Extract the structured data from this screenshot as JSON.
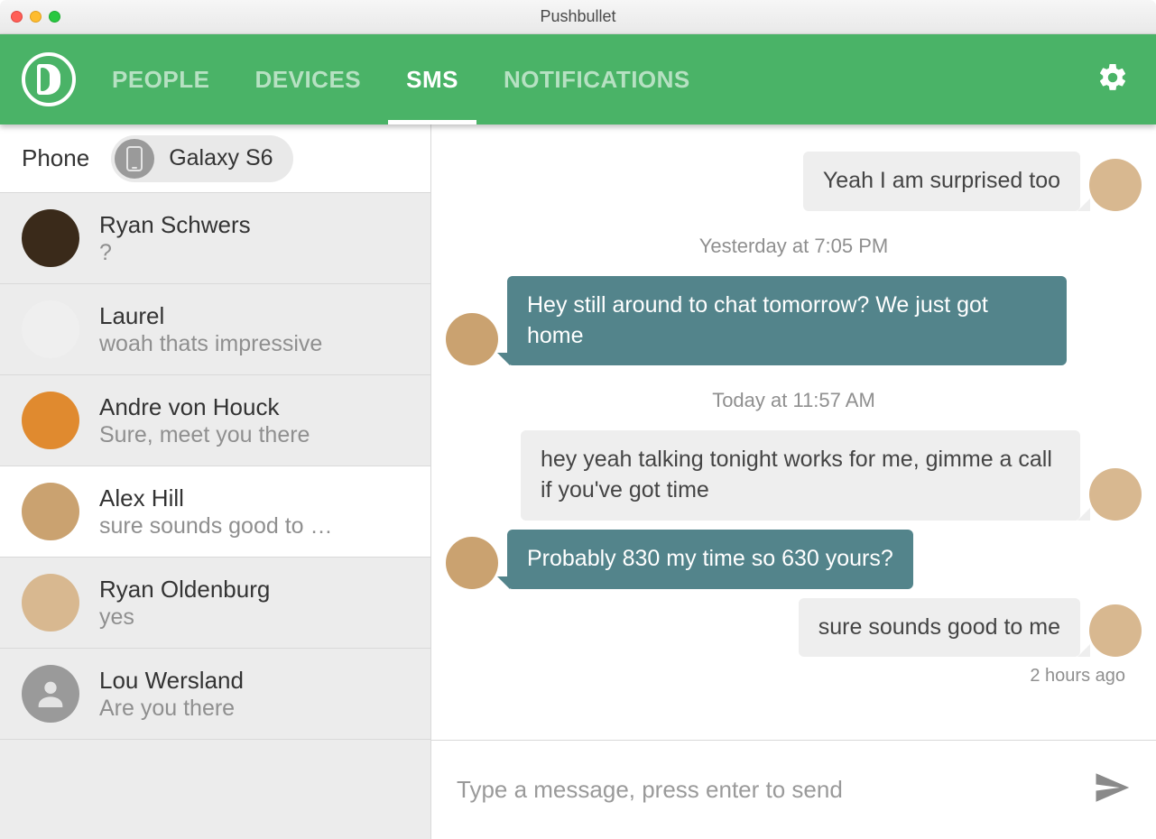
{
  "window": {
    "title": "Pushbullet"
  },
  "header": {
    "tabs": {
      "people": "PEOPLE",
      "devices": "DEVICES",
      "sms": "SMS",
      "notifications": "NOTIFICATIONS"
    },
    "active_tab": "sms"
  },
  "sidebar": {
    "phone_label": "Phone",
    "device_name": "Galaxy S6",
    "conversations": [
      {
        "name": "Ryan Schwers",
        "preview": "?",
        "selected": false,
        "avatar_class": "av-1"
      },
      {
        "name": "Laurel",
        "preview": "woah thats impressive",
        "selected": false,
        "avatar_class": "av-2"
      },
      {
        "name": "Andre von Houck",
        "preview": "Sure, meet you there",
        "selected": false,
        "avatar_class": "av-3"
      },
      {
        "name": "Alex Hill",
        "preview": "sure sounds good to …",
        "selected": true,
        "avatar_class": "av-4"
      },
      {
        "name": "Ryan Oldenburg",
        "preview": "yes",
        "selected": false,
        "avatar_class": "av-5"
      },
      {
        "name": "Lou Wersland",
        "preview": "Are you there",
        "selected": false,
        "avatar_class": "av-6"
      }
    ]
  },
  "chat": {
    "messages": [
      {
        "kind": "out",
        "text": "Yeah I am surprised too"
      },
      {
        "kind": "sep",
        "text": "Yesterday at 7:05 PM"
      },
      {
        "kind": "in",
        "text": "Hey still around to chat tomorrow? We just got home"
      },
      {
        "kind": "sep",
        "text": "Today at 11:57 AM"
      },
      {
        "kind": "out",
        "text": "hey yeah talking tonight works for me, gimme a call if you've got time"
      },
      {
        "kind": "in",
        "text": "Probably 830 my time so 630 yours?"
      },
      {
        "kind": "out",
        "text": "sure sounds good to me"
      }
    ],
    "last_timestamp": "2 hours ago"
  },
  "composer": {
    "placeholder": "Type a message, press enter to send"
  },
  "colors": {
    "brand_green": "#4ab367",
    "bubble_in": "#53848b",
    "bubble_out": "#eeeeee"
  }
}
